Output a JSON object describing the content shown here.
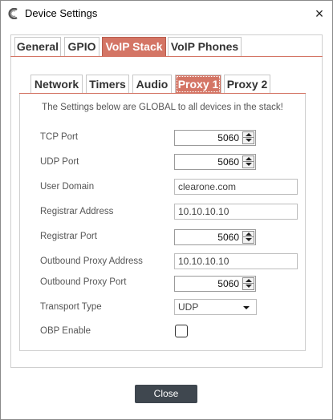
{
  "window": {
    "title": "Device Settings",
    "close_glyph": "×",
    "icon": "clearone-logo-icon"
  },
  "top_tabs": [
    {
      "label": "General",
      "active": false
    },
    {
      "label": "GPIO",
      "active": false
    },
    {
      "label": "VoIP Stack",
      "active": true
    },
    {
      "label": "VoIP Phones",
      "active": false
    }
  ],
  "sub_tabs": [
    {
      "label": "Network",
      "active": false
    },
    {
      "label": "Timers",
      "active": false
    },
    {
      "label": "Audio",
      "active": false
    },
    {
      "label": "Proxy 1",
      "active": true
    },
    {
      "label": "Proxy 2",
      "active": false
    }
  ],
  "notice": "The Settings below are GLOBAL to all devices in the stack!",
  "fields": {
    "tcp_port": {
      "label": "TCP Port",
      "value": "5060"
    },
    "udp_port": {
      "label": "UDP Port",
      "value": "5060"
    },
    "user_domain": {
      "label": "User Domain",
      "value": "clearone.com"
    },
    "registrar_address": {
      "label": "Registrar Address",
      "value": "10.10.10.10"
    },
    "registrar_port": {
      "label": "Registrar Port",
      "value": "5060"
    },
    "outbound_proxy_address": {
      "label": "Outbound Proxy Address",
      "value": "10.10.10.10"
    },
    "outbound_proxy_port": {
      "label": "Outbound Proxy Port",
      "value": "5060"
    },
    "transport_type": {
      "label": "Transport Type",
      "value": "UDP"
    },
    "obp_enable": {
      "label": "OBP Enable",
      "checked": false
    }
  },
  "footer": {
    "close_label": "Close"
  },
  "colors": {
    "active_tab": "#d47565",
    "close_button": "#3f474f"
  }
}
